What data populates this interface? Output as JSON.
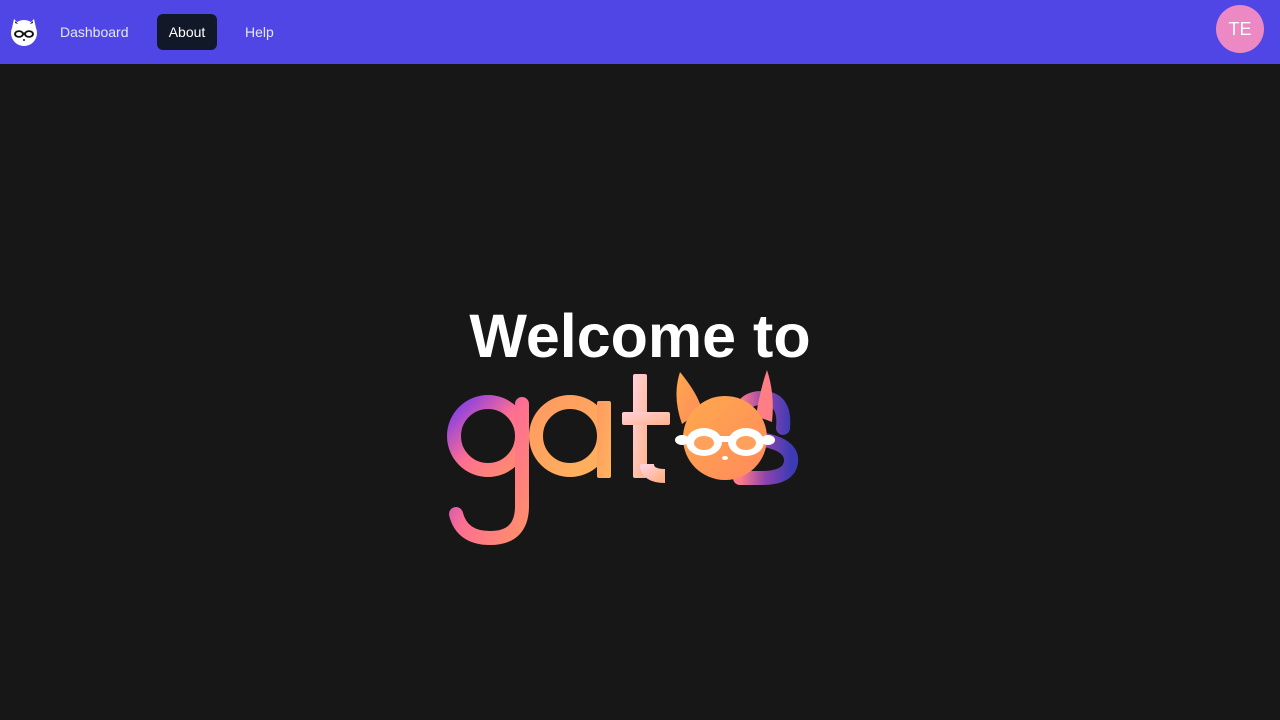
{
  "nav": {
    "logo_icon": "cat-with-glasses-icon",
    "links": [
      {
        "label": "Dashboard",
        "active": false
      },
      {
        "label": "About",
        "active": true
      },
      {
        "label": "Help",
        "active": false
      }
    ],
    "avatar_initials": "TE"
  },
  "main": {
    "title": "Welcome to",
    "logo_text": "gatos",
    "logo_icon": "gatos-cat-logo-icon"
  },
  "colors": {
    "navbar": "#4f46e5",
    "background": "#171717",
    "active_tab": "#111827",
    "avatar": "#ec88c3",
    "logo_gradient": [
      "#7c3aed",
      "#ff6f91",
      "#ffa45c",
      "#ffc7d1",
      "#3b3bb5"
    ]
  }
}
